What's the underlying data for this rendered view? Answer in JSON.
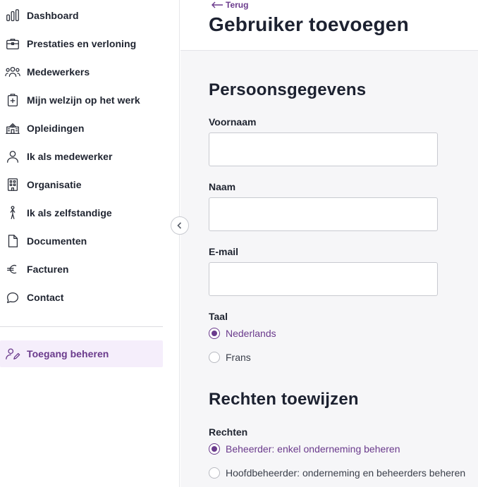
{
  "sidebar": {
    "items": [
      {
        "label": "Dashboard",
        "icon": "bar-chart-icon"
      },
      {
        "label": "Prestaties en verloning",
        "icon": "briefcase-icon"
      },
      {
        "label": "Medewerkers",
        "icon": "users-icon"
      },
      {
        "label": "Mijn welzijn op het werk",
        "icon": "first-aid-icon"
      },
      {
        "label": "Opleidingen",
        "icon": "school-icon"
      },
      {
        "label": "Ik als medewerker",
        "icon": "user-icon"
      },
      {
        "label": "Organisatie",
        "icon": "building-icon"
      },
      {
        "label": "Ik als zelfstandige",
        "icon": "walking-person-icon"
      },
      {
        "label": "Documenten",
        "icon": "document-icon"
      },
      {
        "label": "Facturen",
        "icon": "euro-icon"
      },
      {
        "label": "Contact",
        "icon": "chat-bubble-icon"
      }
    ],
    "bottom_item": {
      "label": "Toegang beheren",
      "icon": "user-edit-icon"
    }
  },
  "header": {
    "back_label": "Terug",
    "title": "Gebruiker toevoegen"
  },
  "personal": {
    "title": "Persoonsgegevens",
    "first_name_label": "Voornaam",
    "first_name_value": "",
    "last_name_label": "Naam",
    "last_name_value": "",
    "email_label": "E-mail",
    "email_value": "",
    "language_label": "Taal",
    "language_options": [
      "Nederlands",
      "Frans"
    ],
    "language_selected": "Nederlands"
  },
  "rights": {
    "title": "Rechten toewijzen",
    "label": "Rechten",
    "options": [
      "Beheerder: enkel onderneming beheren",
      "Hoofdbeheerder: onderneming en beheerders beheren"
    ],
    "selected": "Beheerder: enkel onderneming beheren"
  },
  "colors": {
    "accent": "#6a3a8c",
    "active_bg": "#f5eefb",
    "main_bg": "#f6f6f8"
  }
}
